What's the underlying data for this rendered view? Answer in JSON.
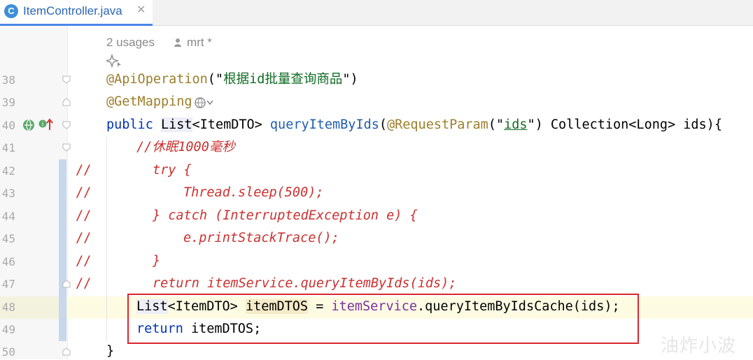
{
  "tab": {
    "title": "ItemController.java",
    "class_icon": "C",
    "close_glyph": "✕"
  },
  "inlay": {
    "usages": "2 usages",
    "author": "mrt *"
  },
  "lines": [
    "38",
    "39",
    "40",
    "41",
    "42",
    "43",
    "44",
    "45",
    "46",
    "47",
    "48",
    "49",
    "50"
  ],
  "code": {
    "l38_annotation": "@ApiOperation",
    "l38_open": "(\"",
    "l38_string": "根据id批量查询商品",
    "l38_close": "\")",
    "l39_annotation": "@GetMapping",
    "l40_public": "public ",
    "l40_list": "List",
    "l40_generic": "<ItemDTO> ",
    "l40_method": "queryItemByIds",
    "l40_paren": "(",
    "l40_reqparam": "@RequestParam",
    "l40_q1": "(\"",
    "l40_ids": "ids",
    "l40_q2": "\")",
    "l40_rest": " Collection<Long> ids){",
    "l41_comment": "//休眠1000毫秒",
    "l42_slash": "//",
    "l42_code": "try {",
    "l43_slash": "//",
    "l43_code": "Thread.sleep(500);",
    "l44_slash": "//",
    "l44_code": "} catch (InterruptedException e) {",
    "l45_slash": "//",
    "l45_code": "e.printStackTrace();",
    "l46_slash": "//",
    "l46_code": "}",
    "l47_slash": "//",
    "l47_code": "return itemService.queryItemByIds(ids);",
    "l48_list": "List",
    "l48_generic": "<ItemDTO> ",
    "l48_var": "itemDTOS",
    "l48_eq": " = ",
    "l48_service": "itemService",
    "l48_call": ".queryItemByIdsCache(ids);",
    "l49_return": "return ",
    "l49_rest": "itemDTOS;",
    "l50_brace": "}"
  },
  "watermark": "油炸小波",
  "colors": {
    "annotation": "#9d7e2a",
    "string": "#116b24",
    "keyword": "#0033b3",
    "comment": "#cc3030",
    "field": "#7a2fa0",
    "highlight_border": "#d9262e",
    "tab_accent": "#4a86e8"
  },
  "icons": [
    "class-icon",
    "close-icon",
    "person-icon",
    "ai-sparkle-icon",
    "web-globe-icon",
    "chevron-down-icon",
    "run-endpoint-icon",
    "implemented-up-icon",
    "fold-marker-icon"
  ]
}
